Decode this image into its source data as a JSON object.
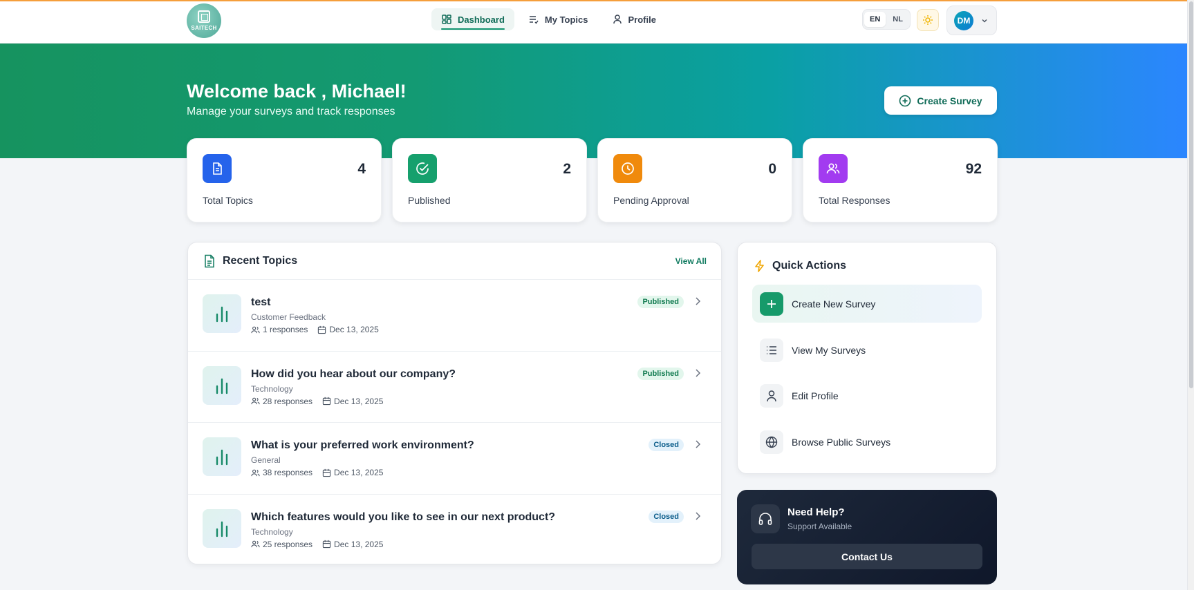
{
  "brand": {
    "logo_text": "SAITECH"
  },
  "nav": {
    "items": [
      {
        "label": "Dashboard",
        "icon": "dashboard-icon",
        "active": true
      },
      {
        "label": "My Topics",
        "icon": "list-check-icon",
        "active": false
      },
      {
        "label": "Profile",
        "icon": "user-icon",
        "active": false
      }
    ],
    "languages": [
      "EN",
      "NL"
    ],
    "selected_language": "EN",
    "user_initials": "DM"
  },
  "hero": {
    "welcome": "Welcome back , Michael!",
    "subtitle": "Manage your surveys and track responses",
    "create_button": "Create Survey"
  },
  "stats": [
    {
      "label": "Total Topics",
      "value": "4",
      "icon": "document-icon",
      "color": "#2563eb"
    },
    {
      "label": "Published",
      "value": "2",
      "icon": "check-circle-icon",
      "color": "#16a06d"
    },
    {
      "label": "Pending Approval",
      "value": "0",
      "icon": "clock-icon",
      "color": "#f08a0c"
    },
    {
      "label": "Total Responses",
      "value": "92",
      "icon": "users-icon",
      "color": "#a23bf0"
    }
  ],
  "recent": {
    "title": "Recent Topics",
    "view_all": "View All",
    "topics": [
      {
        "title": "test",
        "category": "Customer Feedback",
        "responses": "1 responses",
        "date": "Dec 13, 2025",
        "status": "Published"
      },
      {
        "title": "How did you hear about our company?",
        "category": "Technology",
        "responses": "28 responses",
        "date": "Dec 13, 2025",
        "status": "Published"
      },
      {
        "title": "What is your preferred work environment?",
        "category": "General",
        "responses": "38 responses",
        "date": "Dec 13, 2025",
        "status": "Closed"
      },
      {
        "title": "Which features would you like to see in our next product?",
        "category": "Technology",
        "responses": "25 responses",
        "date": "Dec 13, 2025",
        "status": "Closed"
      }
    ]
  },
  "quick_actions": {
    "title": "Quick Actions",
    "items": [
      {
        "label": "Create New Survey",
        "icon": "plus-icon"
      },
      {
        "label": "View My Surveys",
        "icon": "list-icon"
      },
      {
        "label": "Edit Profile",
        "icon": "user-icon"
      },
      {
        "label": "Browse Public Surveys",
        "icon": "globe-icon"
      }
    ]
  },
  "help": {
    "title": "Need Help?",
    "subtitle": "Support Available",
    "button": "Contact Us"
  }
}
